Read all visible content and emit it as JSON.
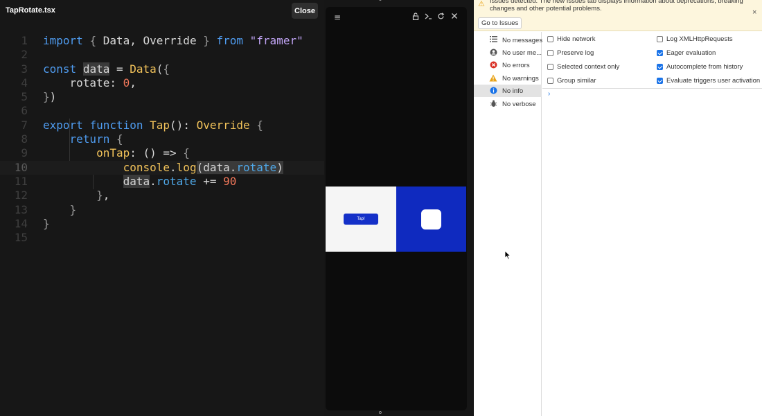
{
  "editor": {
    "file_name": "TapRotate.tsx",
    "close_label": "Close",
    "line_numbers": [
      "1",
      "2",
      "3",
      "4",
      "5",
      "6",
      "7",
      "8",
      "9",
      "10",
      "11",
      "12",
      "13",
      "14",
      "15"
    ]
  },
  "preview": {
    "menu_icon": "≡",
    "tap_label": "Tap!"
  },
  "devtools": {
    "issues_text": "Issues detected. The new Issues tab displays information about deprecations, breaking changes and other potential problems.",
    "goto_issues_label": "Go to Issues",
    "sidebar": [
      {
        "label": "No messages",
        "icon": "list-icon"
      },
      {
        "label": "No user me...",
        "icon": "user-icon"
      },
      {
        "label": "No errors",
        "icon": "error-icon"
      },
      {
        "label": "No warnings",
        "icon": "warning-icon"
      },
      {
        "label": "No info",
        "icon": "info-icon"
      },
      {
        "label": "No verbose",
        "icon": "bug-icon"
      }
    ],
    "options_left": [
      {
        "label": "Hide network",
        "checked": false
      },
      {
        "label": "Preserve log",
        "checked": false
      },
      {
        "label": "Selected context only",
        "checked": false
      },
      {
        "label": "Group similar",
        "checked": false
      }
    ],
    "options_right": [
      {
        "label": "Log XMLHttpRequests",
        "checked": false
      },
      {
        "label": "Eager evaluation",
        "checked": true
      },
      {
        "label": "Autocomplete from history",
        "checked": true
      },
      {
        "label": "Evaluate triggers user activation",
        "checked": true
      }
    ],
    "prompt": "›"
  },
  "colors": {
    "accent": "#1a73e8",
    "frame_blue": "#0f2abf",
    "button_blue": "#1430c8"
  }
}
